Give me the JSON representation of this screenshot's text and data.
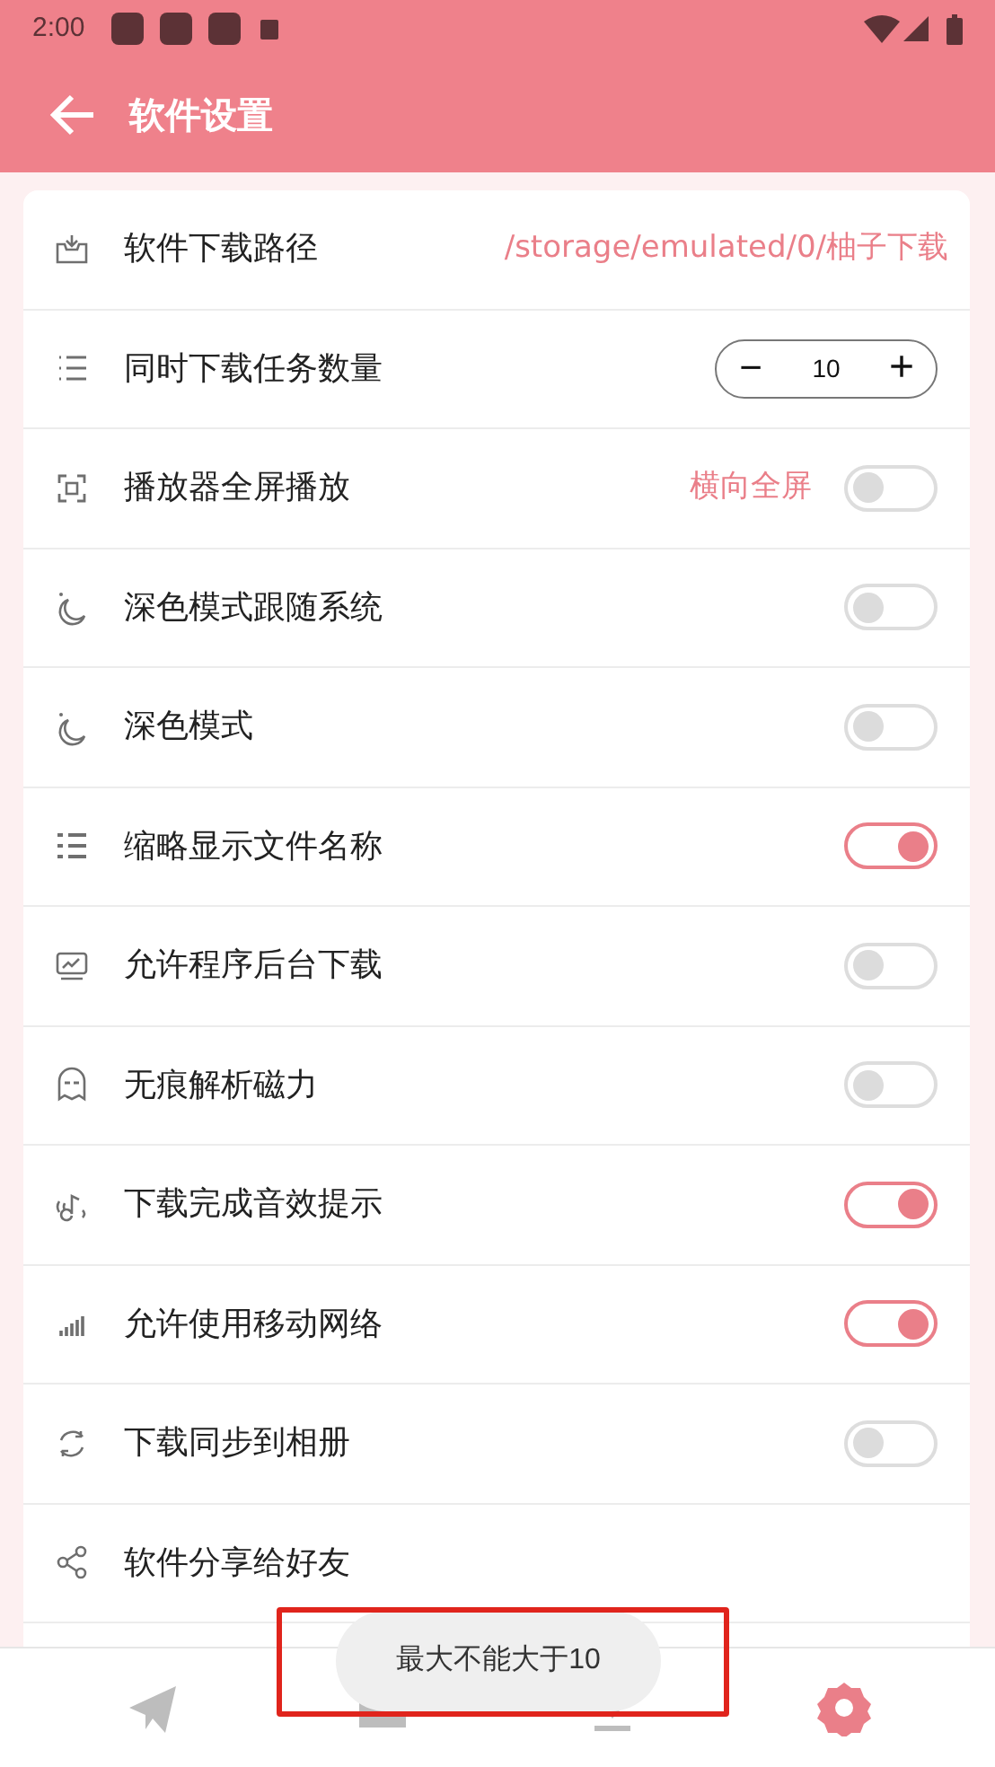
{
  "status_bar": {
    "time": "2:00"
  },
  "app_bar": {
    "title": "软件设置"
  },
  "settings": [
    {
      "kind": "path",
      "label": "软件下载路径",
      "value": "/storage/emulated/0/柚子下载"
    },
    {
      "kind": "stepper",
      "label": "同时下载任务数量",
      "minus": "−",
      "value": "10",
      "plus": "+"
    },
    {
      "kind": "toggle",
      "label": "播放器全屏播放",
      "value": "横向全屏",
      "on": false
    },
    {
      "kind": "toggle",
      "label": "深色模式跟随系统",
      "on": false
    },
    {
      "kind": "toggle",
      "label": "深色模式",
      "on": false
    },
    {
      "kind": "toggle",
      "label": "缩略显示文件名称",
      "on": true
    },
    {
      "kind": "toggle",
      "label": "允许程序后台下载",
      "on": false
    },
    {
      "kind": "toggle",
      "label": "无痕解析磁力",
      "on": false
    },
    {
      "kind": "toggle",
      "label": "下载完成音效提示",
      "on": true
    },
    {
      "kind": "toggle",
      "label": "允许使用移动网络",
      "on": true
    },
    {
      "kind": "toggle",
      "label": "下载同步到相册",
      "on": false
    },
    {
      "kind": "link",
      "label": "软件分享给好友"
    }
  ],
  "bottom_nav": [
    {
      "selected": false
    },
    {
      "selected": false
    },
    {
      "selected": false
    },
    {
      "selected": true
    }
  ],
  "toast": {
    "text": "最大不能大于10"
  }
}
